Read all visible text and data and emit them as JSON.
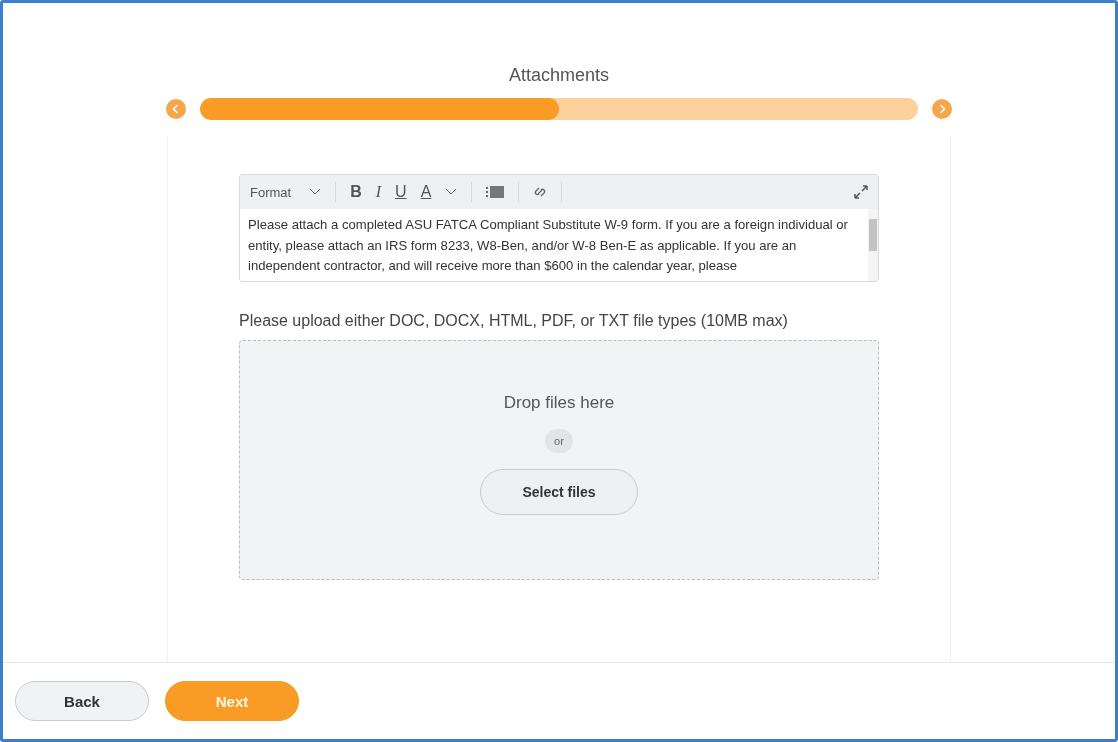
{
  "header": {
    "title": "Attachments"
  },
  "progress": {
    "level": 0.5
  },
  "editor": {
    "format_label": "Format",
    "bold_label": "B",
    "italic_label": "I",
    "underline_label": "U",
    "color_label": "A",
    "text": "Please attach a completed ASU FATCA Compliant Substitute W-9 form. If you are a foreign individual or entity, please attach an IRS form 8233, W8-Ben, and/or W-8 Ben-E as applicable. If you are an independent contractor, and will receive more than $600 in the calendar year, please"
  },
  "upload": {
    "instructions": "Please upload either DOC, DOCX, HTML, PDF, or TXT file types (10MB max)",
    "drop_text": "Drop files here",
    "or_text": "or",
    "select_button": "Select files"
  },
  "footer": {
    "buttons": [
      {
        "label": "Back",
        "kind": "secondary"
      },
      {
        "label": "Next",
        "kind": "primary"
      }
    ]
  }
}
